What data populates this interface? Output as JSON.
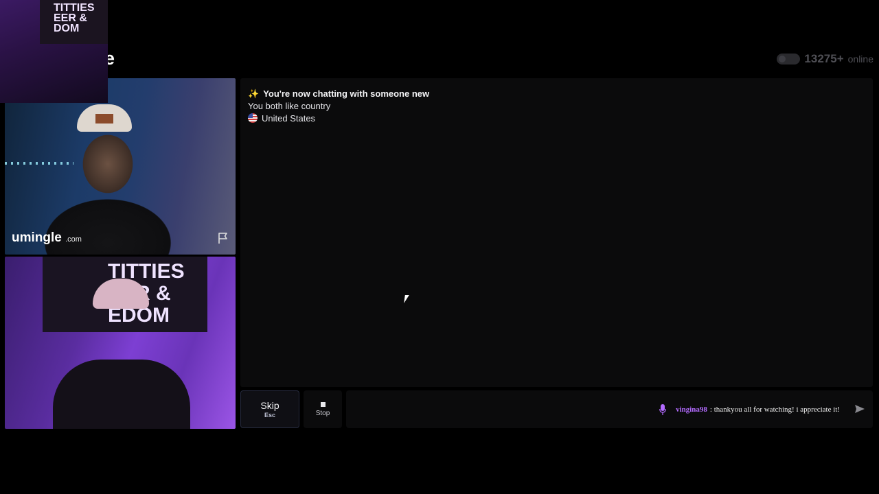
{
  "header": {
    "logo_partial": "e",
    "online_count": "13275+",
    "online_label": "online"
  },
  "overlay": {
    "banner_text": "TITTIES\nEER &\nDOM"
  },
  "stranger_video": {
    "brand_main": "umingle",
    "brand_suffix": ".com",
    "report_icon": "flag-icon"
  },
  "self_video": {
    "banner_text": "TITTIES\nEER &\nEDOM"
  },
  "chat": {
    "status_title": "You're now chatting with someone new",
    "interest_line": "You both like country",
    "country": "United States",
    "status_icon": "sparkles-icon",
    "country_icon": "us-flag-icon"
  },
  "controls": {
    "skip_label": "Skip",
    "skip_shortcut": "Esc",
    "stop_label": "Stop"
  },
  "stream_alert": {
    "username": "vingina98",
    "message": ": thankyou all for watching! i appreciate it!",
    "icon": "microphone-icon"
  },
  "colors": {
    "accent_purple": "#b36bff",
    "panel_bg": "#0b0b0c",
    "page_bg": "#000000"
  }
}
